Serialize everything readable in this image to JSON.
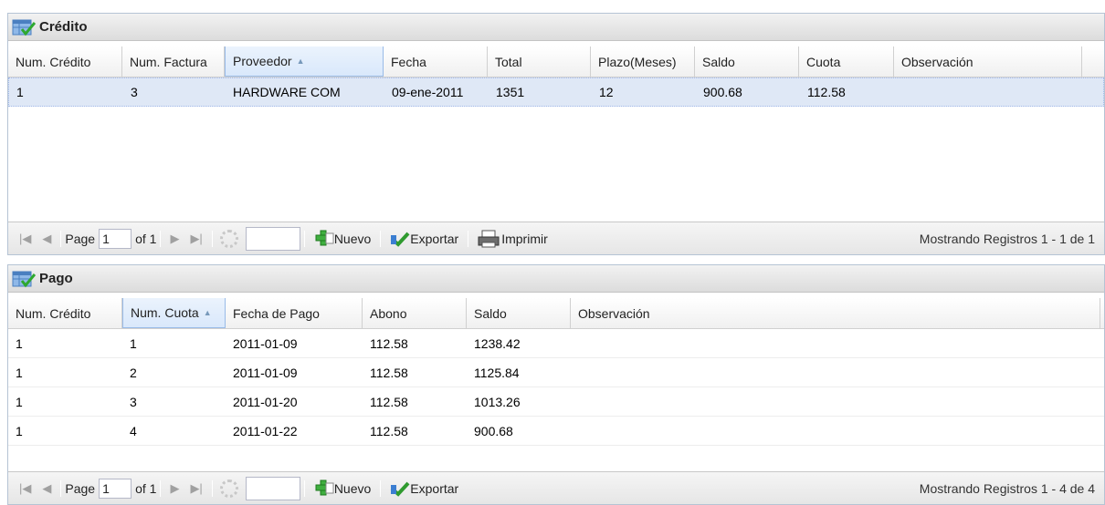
{
  "credito": {
    "title": "Crédito",
    "columns": [
      "Num. Crédito",
      "Num. Factura",
      "Proveedor",
      "Fecha",
      "Total",
      "Plazo(Meses)",
      "Saldo",
      "Cuota",
      "Observación"
    ],
    "rows": [
      [
        "1",
        "3",
        "HARDWARE COM",
        "09-ene-2011",
        "1351",
        "12",
        "900.68",
        "112.58",
        ""
      ]
    ],
    "toolbar": {
      "page_label": "Page",
      "page_value": "1",
      "of_label": "of 1",
      "nuevo": "Nuevo",
      "exportar": "Exportar",
      "imprimir": "Imprimir",
      "info": "Mostrando Registros 1 - 1 de 1"
    }
  },
  "pago": {
    "title": "Pago",
    "columns": [
      "Num. Crédito",
      "Num. Cuota",
      "Fecha de Pago",
      "Abono",
      "Saldo",
      "Observación"
    ],
    "rows": [
      [
        "1",
        "1",
        "2011-01-09",
        "112.58",
        "1238.42",
        ""
      ],
      [
        "1",
        "2",
        "2011-01-09",
        "112.58",
        "1125.84",
        ""
      ],
      [
        "1",
        "3",
        "2011-01-20",
        "112.58",
        "1013.26",
        ""
      ],
      [
        "1",
        "4",
        "2011-01-22",
        "112.58",
        "900.68",
        ""
      ]
    ],
    "toolbar": {
      "page_label": "Page",
      "page_value": "1",
      "of_label": "of 1",
      "nuevo": "Nuevo",
      "exportar": "Exportar",
      "info": "Mostrando Registros 1 - 4 de 4"
    }
  },
  "icons": {
    "panel": "table-check-icon",
    "first": "first-page-icon",
    "prev": "prev-page-icon",
    "next": "next-page-icon",
    "last": "last-page-icon",
    "refresh": "refresh-icon",
    "add": "add-icon",
    "export": "export-icon",
    "print": "print-icon"
  }
}
